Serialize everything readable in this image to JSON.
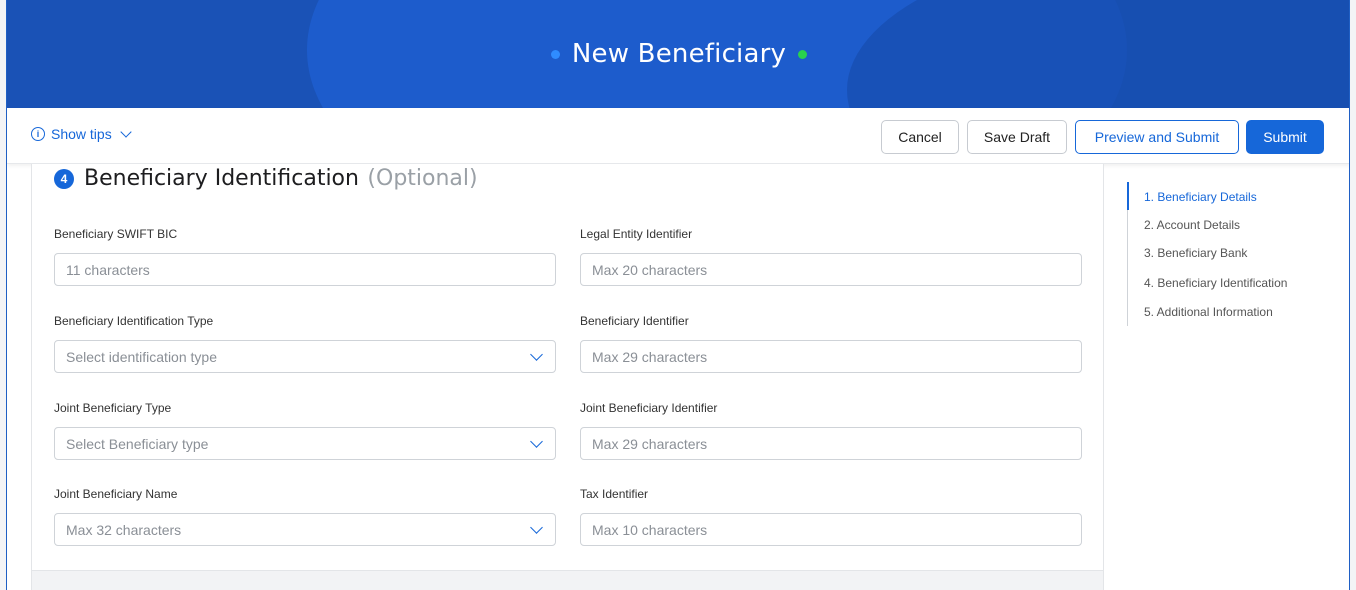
{
  "banner": {
    "title": "New Beneficiary"
  },
  "toolbar": {
    "tips_label": "Show tips",
    "cancel_label": "Cancel",
    "save_draft_label": "Save Draft",
    "preview_label": "Preview and Submit",
    "submit_label": "Submit"
  },
  "section": {
    "number": "4",
    "title": "Beneficiary Identification",
    "optional": "(Optional)"
  },
  "fields": {
    "swift_bic": {
      "label": "Beneficiary SWIFT BIC",
      "placeholder": "11 characters"
    },
    "lei": {
      "label": "Legal Entity Identifier",
      "placeholder": "Max 20 characters"
    },
    "id_type": {
      "label": "Beneficiary Identification Type",
      "placeholder": "Select identification type"
    },
    "identifier": {
      "label": "Beneficiary Identifier",
      "placeholder": "Max 29 characters"
    },
    "joint_type": {
      "label": "Joint Beneficiary Type",
      "placeholder": "Select Beneficiary type"
    },
    "joint_identifier": {
      "label": "Joint Beneficiary Identifier",
      "placeholder": "Max 29 characters"
    },
    "joint_name": {
      "label": "Joint Beneficiary Name",
      "placeholder": "Max 32 characters"
    },
    "tax_id": {
      "label": "Tax Identifier",
      "placeholder": "Max 10 characters"
    }
  },
  "steps_nav": {
    "items": [
      {
        "label": "1. Beneficiary Details",
        "active": true
      },
      {
        "label": "2. Account Details",
        "active": false
      },
      {
        "label": "3. Beneficiary Bank",
        "active": false
      },
      {
        "label": "4. Beneficiary Identification",
        "active": false
      },
      {
        "label": "5. Additional Information",
        "active": false
      }
    ]
  },
  "colors": {
    "primary": "#1667d9",
    "banner": "#1b57be",
    "accent_green": "#29d14e"
  }
}
